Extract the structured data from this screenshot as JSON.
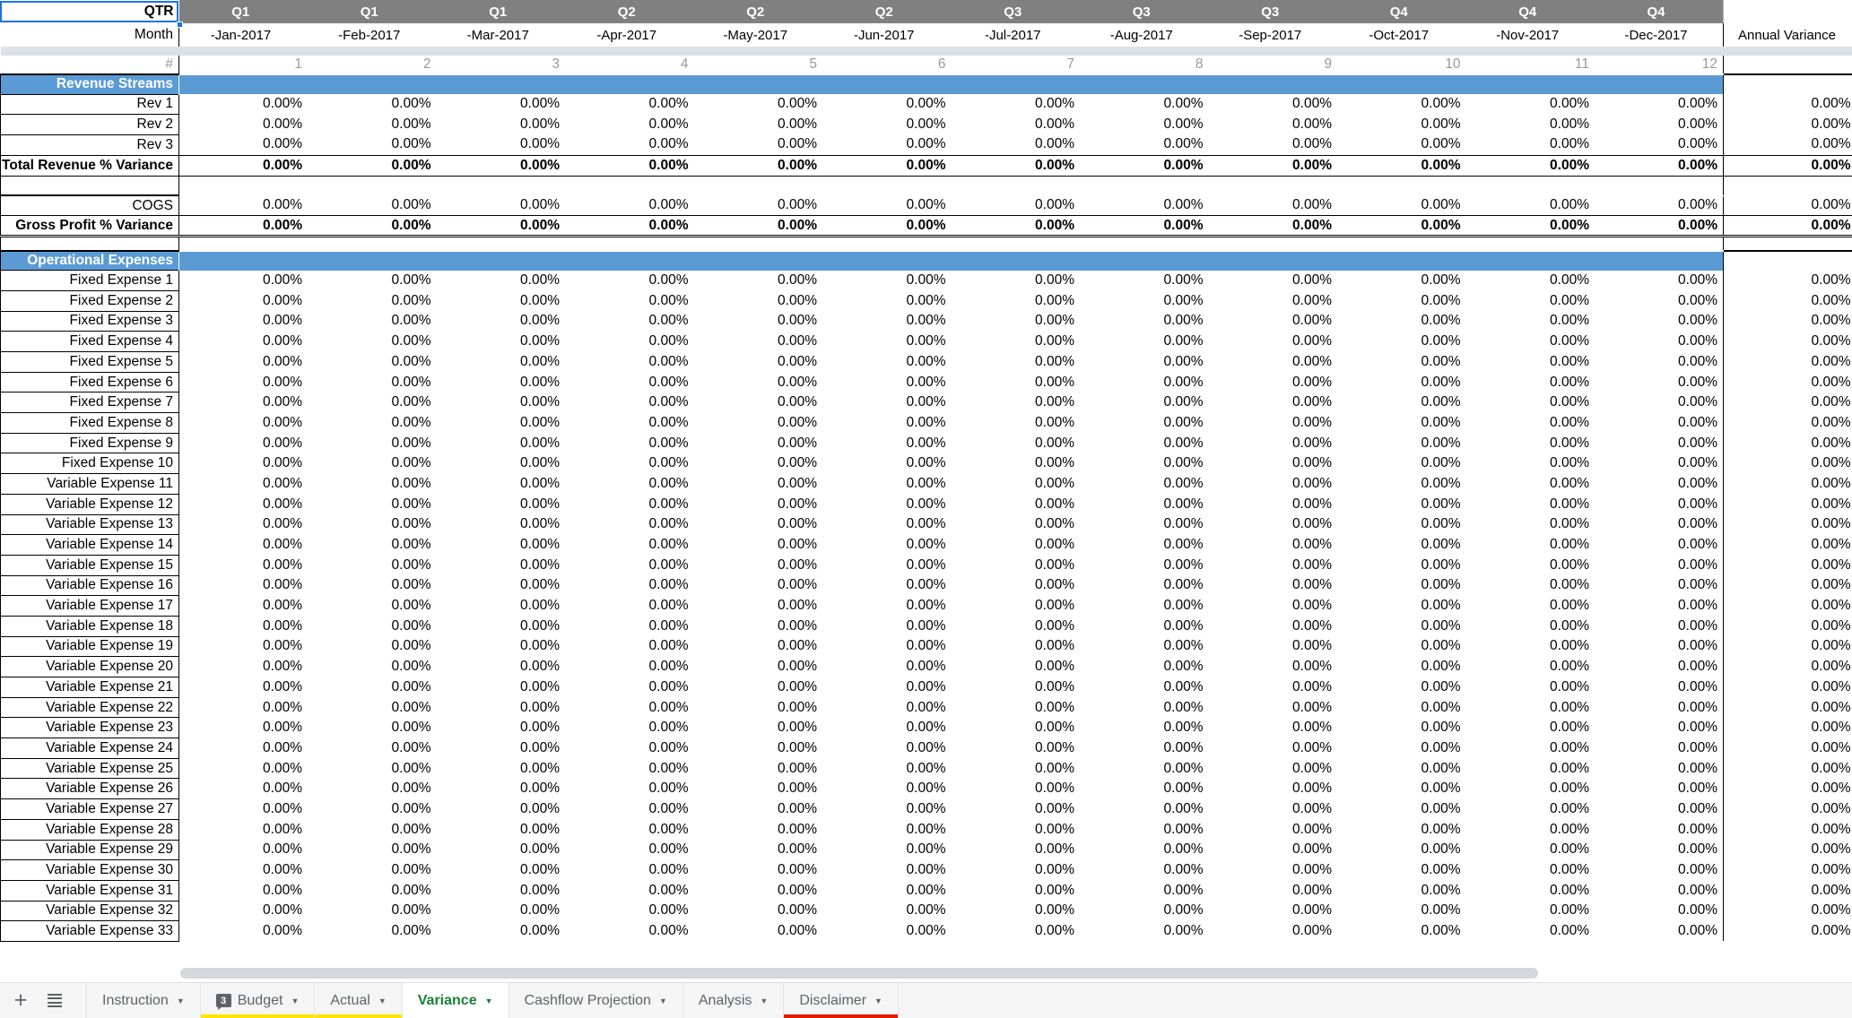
{
  "header": {
    "qtr_label": "QTR",
    "month_label": "Month",
    "hash_label": "#",
    "annual_label": "Annual Variance",
    "quarters": [
      "Q1",
      "Q1",
      "Q1",
      "Q2",
      "Q2",
      "Q2",
      "Q3",
      "Q3",
      "Q3",
      "Q4",
      "Q4",
      "Q4"
    ],
    "months": [
      "-Jan-2017",
      "-Feb-2017",
      "-Mar-2017",
      "-Apr-2017",
      "-May-2017",
      "-Jun-2017",
      "-Jul-2017",
      "-Aug-2017",
      "-Sep-2017",
      "-Oct-2017",
      "-Nov-2017",
      "-Dec-2017"
    ],
    "indices": [
      "1",
      "2",
      "3",
      "4",
      "5",
      "6",
      "7",
      "8",
      "9",
      "10",
      "11",
      "12"
    ]
  },
  "colors": {
    "banner_blue": "#5b9bd5",
    "qtr_gray": "#808080",
    "selection_blue": "#1a73e8",
    "active_tab_green": "#188038",
    "budget_underline": "#ffe500",
    "actual_underline": "#ffe500",
    "disclaimer_underline": "#e01b00"
  },
  "value": "0.00%",
  "sections": [
    {
      "banner": "Revenue Streams",
      "rows": [
        {
          "label": "Rev 1",
          "style": "data"
        },
        {
          "label": "Rev 2",
          "style": "data"
        },
        {
          "label": "Rev 3",
          "style": "data"
        },
        {
          "label": "Total Revenue % Variance",
          "style": "total"
        },
        {
          "label": "",
          "style": "blank"
        },
        {
          "label": "COGS",
          "style": "data"
        },
        {
          "label": "Gross Profit % Variance",
          "style": "total-dbl"
        }
      ]
    },
    {
      "banner": "Operational Expenses",
      "rows": [
        {
          "label": "Fixed Expense 1",
          "style": "data"
        },
        {
          "label": "Fixed Expense 2",
          "style": "data"
        },
        {
          "label": "Fixed Expense 3",
          "style": "data"
        },
        {
          "label": "Fixed Expense 4",
          "style": "data"
        },
        {
          "label": "Fixed Expense 5",
          "style": "data"
        },
        {
          "label": "Fixed Expense 6",
          "style": "data"
        },
        {
          "label": "Fixed Expense 7",
          "style": "data"
        },
        {
          "label": "Fixed Expense 8",
          "style": "data"
        },
        {
          "label": "Fixed Expense 9",
          "style": "data"
        },
        {
          "label": "Fixed Expense 10",
          "style": "data"
        },
        {
          "label": "Variable Expense 11",
          "style": "data"
        },
        {
          "label": "Variable Expense 12",
          "style": "data"
        },
        {
          "label": "Variable Expense 13",
          "style": "data"
        },
        {
          "label": "Variable Expense 14",
          "style": "data"
        },
        {
          "label": "Variable Expense 15",
          "style": "data"
        },
        {
          "label": "Variable Expense 16",
          "style": "data"
        },
        {
          "label": "Variable Expense 17",
          "style": "data"
        },
        {
          "label": "Variable Expense 18",
          "style": "data"
        },
        {
          "label": "Variable Expense 19",
          "style": "data"
        },
        {
          "label": "Variable Expense 20",
          "style": "data"
        },
        {
          "label": "Variable Expense 21",
          "style": "data"
        },
        {
          "label": "Variable Expense 22",
          "style": "data"
        },
        {
          "label": "Variable Expense 23",
          "style": "data"
        },
        {
          "label": "Variable Expense 24",
          "style": "data"
        },
        {
          "label": "Variable Expense 25",
          "style": "data"
        },
        {
          "label": "Variable Expense 26",
          "style": "data"
        },
        {
          "label": "Variable Expense 27",
          "style": "data"
        },
        {
          "label": "Variable Expense 28",
          "style": "data"
        },
        {
          "label": "Variable Expense 29",
          "style": "data"
        },
        {
          "label": "Variable Expense 30",
          "style": "data"
        },
        {
          "label": "Variable Expense 31",
          "style": "data"
        },
        {
          "label": "Variable Expense 32",
          "style": "data"
        },
        {
          "label": "Variable Expense 33",
          "style": "data"
        }
      ]
    }
  ],
  "tabbar": {
    "add_sheet": "+",
    "all_sheets": "all-sheets",
    "tabs": [
      {
        "label": "Instruction",
        "active": false,
        "badge": null,
        "underline": null
      },
      {
        "label": "Budget",
        "active": false,
        "badge": "3",
        "underline": "#ffe500"
      },
      {
        "label": "Actual",
        "active": false,
        "badge": null,
        "underline": "#ffe500"
      },
      {
        "label": "Variance",
        "active": true,
        "badge": null,
        "underline": null
      },
      {
        "label": "Cashflow Projection",
        "active": false,
        "badge": null,
        "underline": null
      },
      {
        "label": "Analysis",
        "active": false,
        "badge": null,
        "underline": null
      },
      {
        "label": "Disclaimer",
        "active": false,
        "badge": null,
        "underline": "#e01b00"
      }
    ]
  }
}
